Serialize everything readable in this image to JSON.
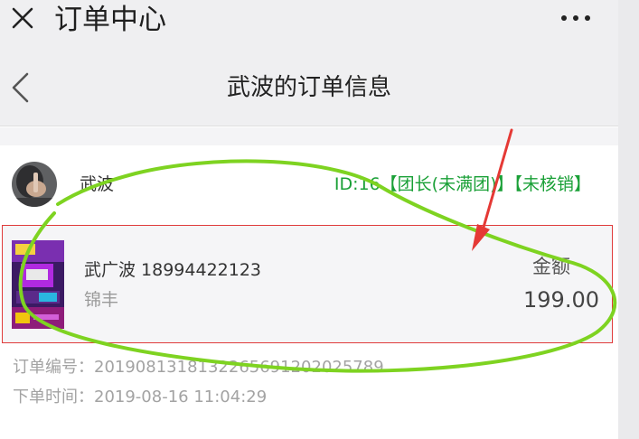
{
  "window": {
    "title": "订单中心",
    "close_icon": "close-icon",
    "more_icon": "more-dots-icon"
  },
  "nav": {
    "back_icon": "chevron-left-icon",
    "title": "武波的订单信息"
  },
  "user": {
    "avatar": "avatar",
    "name": "武波",
    "tags": "ID:16【团长(未满团)】【未核销】",
    "tag_color": "#1aa037"
  },
  "order": {
    "buyer": "武广波 18994422123",
    "store": "锦丰",
    "amount_label": "金额",
    "amount": "199.00",
    "thumbnail": "product-thumbnail-image",
    "order_number_label": "订单编号：",
    "order_number": "2019081318132265691202025789",
    "order_time_label": "下单时间：",
    "order_time": "2019-08-16 11:04:29"
  },
  "annotations": {
    "highlight_box_color": "#e03b3b",
    "circle_color": "#7ed321",
    "arrow_color": "#e53935"
  }
}
